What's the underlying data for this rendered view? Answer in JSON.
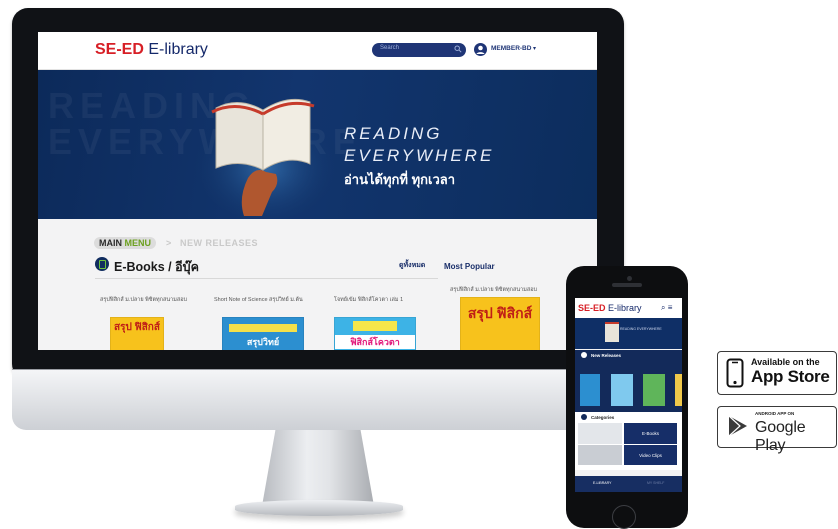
{
  "desktop": {
    "brand": {
      "primary": "SE-ED",
      "secondary": "E-library"
    },
    "search": {
      "placeholder": "Search"
    },
    "user": {
      "name": "MEMBER-BD",
      "caret": "▾"
    },
    "hero": {
      "line1": "READING",
      "line2": "EVERYWHERE",
      "line3": "อ่านได้ทุกที่ ทุกเวลา",
      "background_text": "READING\nEVERYWHERE"
    },
    "breadcrumb": {
      "main_a": "MAIN",
      "main_b": "MENU",
      "separator": ">",
      "current": "NEW RELEASES"
    },
    "section": {
      "title": "E-Books / อีบุ๊ค",
      "see_all": "ดูทั้งหมด",
      "popular_title": "Most Popular"
    },
    "books": [
      {
        "title": "สรุปฟิสิกส์ ม.ปลาย พิชิตทุกสนามสอบ",
        "cover_text": "สรุป ฟิสิกส์"
      },
      {
        "title": "Short Note of Science สรุปวิทย์ ม.ต้น",
        "cover_text": "สรุปวิทย์"
      },
      {
        "title": "โจทย์เข้ม ฟิสิกส์โควตา เล่ม 1",
        "cover_text": "ฟิสิกส์โควตา"
      }
    ],
    "popular_book": {
      "title": "สรุปฟิสิกส์ ม.ปลาย พิชิตทุกสนามสอบ",
      "cover_text": "สรุป ฟิสิกส์"
    }
  },
  "phone": {
    "brand": {
      "primary": "SE-ED",
      "secondary": "E-library"
    },
    "icons": "⌕ ≡",
    "hero_text": "READING EVERYWHERE",
    "new_releases": "New Releases",
    "categories": "Categories",
    "ebooks": "E-Books",
    "video_clips": "Video Clips",
    "footer_left": "E-LIBRARY",
    "footer_right": "MY SHELF"
  },
  "badges": {
    "appstore_small": "Available on the",
    "appstore_big": "App Store",
    "gplay_small": "ANDROID APP ON",
    "gplay_big": "Google Play"
  },
  "colors": {
    "navy": "#15296a",
    "brand_red": "#d71f26",
    "menu_green": "#6ca01f"
  }
}
